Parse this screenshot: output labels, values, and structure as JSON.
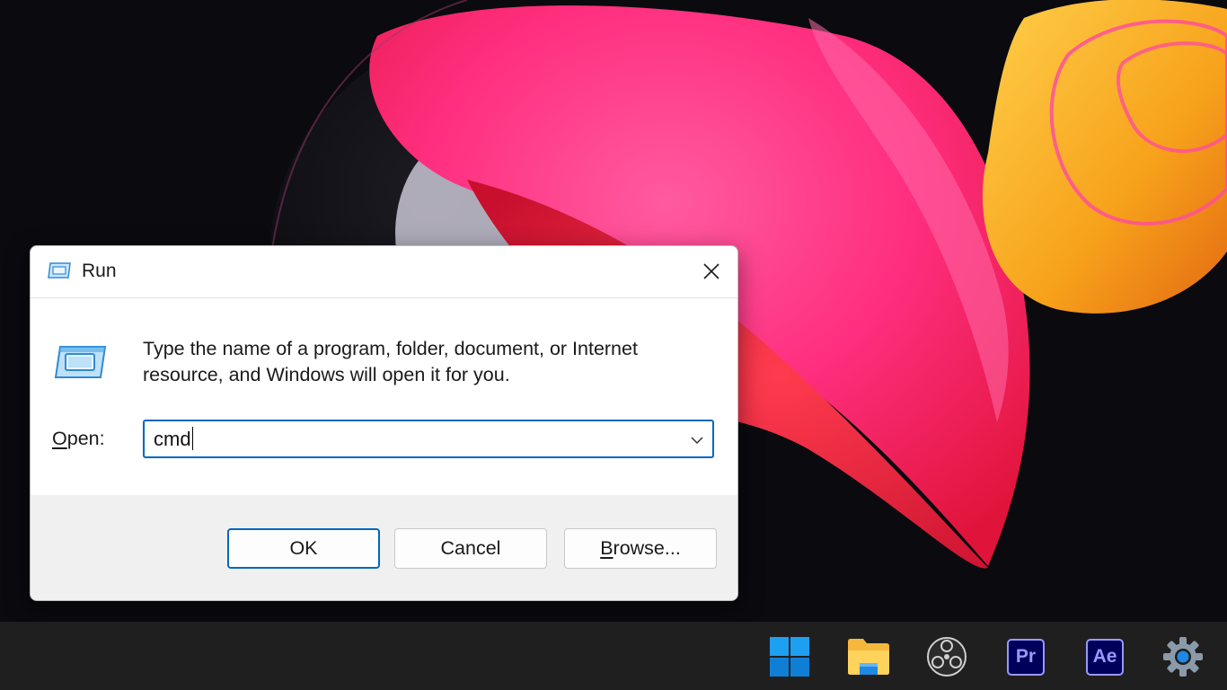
{
  "dialog": {
    "title": "Run",
    "description": "Type the name of a program, folder, document, or Internet resource, and Windows will open it for you.",
    "open_label_mnemonic": "O",
    "open_label_rest": "pen:",
    "open_value": "cmd",
    "ok_label": "OK",
    "cancel_label": "Cancel",
    "browse_mnemonic": "B",
    "browse_rest": "rowse...",
    "accent_color": "#0067c0",
    "close_icon": "close-icon",
    "dropdown_icon": "chevron-down-icon"
  },
  "taskbar": {
    "items": [
      {
        "name": "start",
        "icon": "windows-logo-icon"
      },
      {
        "name": "file-explorer",
        "icon": "folder-icon"
      },
      {
        "name": "obs-studio",
        "icon": "obs-icon"
      },
      {
        "name": "premiere-pro",
        "icon": "premiere-pro-icon",
        "label": "Pr"
      },
      {
        "name": "after-effects",
        "icon": "after-effects-icon",
        "label": "Ae"
      },
      {
        "name": "settings",
        "icon": "gear-icon"
      }
    ]
  },
  "wallpaper": {
    "colors": [
      "#ff2e7e",
      "#f7a21b",
      "#0a0a0f"
    ]
  }
}
